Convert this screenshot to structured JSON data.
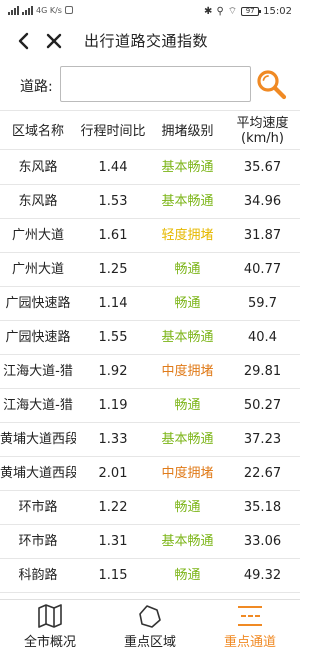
{
  "status_bar": {
    "left_text": "4G K/s",
    "battery": "97",
    "time": "15:02"
  },
  "header": {
    "title": "出行道路交通指数"
  },
  "search": {
    "label": "道路:",
    "value": "",
    "placeholder": ""
  },
  "table": {
    "columns": [
      "区域名称",
      "行程时间比",
      "拥堵级别",
      "平均速度\n(km/h)"
    ],
    "col_speed_line1": "平均速度",
    "col_speed_line2": "(km/h)",
    "rows": [
      {
        "name": "东风路",
        "ratio": "1.44",
        "level": "基本畅通",
        "speed": "35.67"
      },
      {
        "name": "东风路",
        "ratio": "1.53",
        "level": "基本畅通",
        "speed": "34.96"
      },
      {
        "name": "广州大道",
        "ratio": "1.61",
        "level": "轻度拥堵",
        "speed": "31.87"
      },
      {
        "name": "广州大道",
        "ratio": "1.25",
        "level": "畅通",
        "speed": "40.77"
      },
      {
        "name": "广园快速路",
        "ratio": "1.14",
        "level": "畅通",
        "speed": "59.7"
      },
      {
        "name": "广园快速路",
        "ratio": "1.55",
        "level": "基本畅通",
        "speed": "40.4"
      },
      {
        "name": "江海大道-猎",
        "ratio": "1.92",
        "level": "中度拥堵",
        "speed": "29.81"
      },
      {
        "name": "江海大道-猎",
        "ratio": "1.19",
        "level": "畅通",
        "speed": "50.27"
      },
      {
        "name": "黄埔大道西段",
        "ratio": "1.33",
        "level": "基本畅通",
        "speed": "37.23"
      },
      {
        "name": "黄埔大道西段",
        "ratio": "2.01",
        "level": "中度拥堵",
        "speed": "22.67"
      },
      {
        "name": "环市路",
        "ratio": "1.22",
        "level": "畅通",
        "speed": "35.18"
      },
      {
        "name": "环市路",
        "ratio": "1.31",
        "level": "基本畅通",
        "speed": "33.06"
      },
      {
        "name": "科韵路",
        "ratio": "1.15",
        "level": "畅通",
        "speed": "49.32"
      }
    ]
  },
  "level_colors": {
    "畅通": "#7cb518",
    "基本畅通": "#7cb518",
    "轻度拥堵": "#e6b800",
    "中度拥堵": "#e07b1a"
  },
  "bottom_nav": [
    {
      "label": "全市概况",
      "icon": "map-icon",
      "active": false
    },
    {
      "label": "重点区域",
      "icon": "pentagon-icon",
      "active": false
    },
    {
      "label": "重点通道",
      "icon": "lanes-icon",
      "active": true
    }
  ],
  "accent_color": "#f08a24"
}
